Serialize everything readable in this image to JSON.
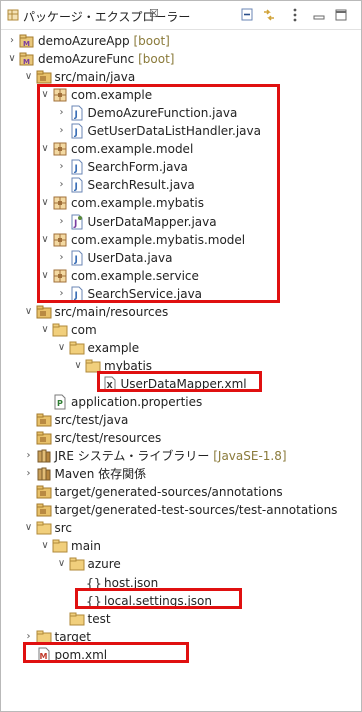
{
  "view": {
    "title": "パッケージ・エクスプローラー",
    "close_glyph": "☒",
    "toolbar": [
      "collapse-all-icon",
      "link-with-editor-icon",
      "view-menu-icon",
      "minimize-icon",
      "maximize-icon"
    ]
  },
  "tree": [
    {
      "label": "demoAzureApp",
      "suffix": " [boot]",
      "icon": "project-icon",
      "arrow": "right"
    },
    {
      "label": "demoAzureFunc",
      "suffix": " [boot]",
      "icon": "project-icon",
      "arrow": "down"
    },
    {
      "label": "src/main/java",
      "icon": "source-folder-icon",
      "arrow": "down"
    },
    {
      "label": "com.example",
      "icon": "package-icon",
      "arrow": "down"
    },
    {
      "label": "DemoAzureFunction.java",
      "icon": "java-file-icon",
      "arrow": "right"
    },
    {
      "label": "GetUserDataListHandler.java",
      "icon": "java-file-icon",
      "arrow": "right"
    },
    {
      "label": "com.example.model",
      "icon": "package-icon",
      "arrow": "down"
    },
    {
      "label": "SearchForm.java",
      "icon": "java-file-icon",
      "arrow": "right"
    },
    {
      "label": "SearchResult.java",
      "icon": "java-file-icon",
      "arrow": "right"
    },
    {
      "label": "com.example.mybatis",
      "icon": "package-icon",
      "arrow": "down"
    },
    {
      "label": "UserDataMapper.java",
      "icon": "java-interface-icon",
      "arrow": "right"
    },
    {
      "label": "com.example.mybatis.model",
      "icon": "package-icon",
      "arrow": "down"
    },
    {
      "label": "UserData.java",
      "icon": "java-file-icon",
      "arrow": "right"
    },
    {
      "label": "com.example.service",
      "icon": "package-icon",
      "arrow": "down"
    },
    {
      "label": "SearchService.java",
      "icon": "java-file-icon",
      "arrow": "right"
    },
    {
      "label": "src/main/resources",
      "icon": "source-folder-icon",
      "arrow": "down"
    },
    {
      "label": "com",
      "icon": "folder-icon",
      "arrow": "down"
    },
    {
      "label": "example",
      "icon": "folder-icon",
      "arrow": "down"
    },
    {
      "label": "mybatis",
      "icon": "folder-icon",
      "arrow": "down"
    },
    {
      "label": "UserDataMapper.xml",
      "icon": "xml-file-icon",
      "arrow": "none"
    },
    {
      "label": "application.properties",
      "icon": "properties-file-icon",
      "arrow": "none"
    },
    {
      "label": "src/test/java",
      "icon": "source-folder-icon",
      "arrow": "none"
    },
    {
      "label": "src/test/resources",
      "icon": "source-folder-icon",
      "arrow": "none"
    },
    {
      "label": "JRE システム・ライブラリー",
      "suffix": " [JavaSE-1.8]",
      "icon": "library-icon",
      "arrow": "right"
    },
    {
      "label": "Maven 依存関係",
      "icon": "library-icon",
      "arrow": "right"
    },
    {
      "label": "target/generated-sources/annotations",
      "icon": "source-folder-icon",
      "arrow": "none"
    },
    {
      "label": "target/generated-test-sources/test-annotations",
      "icon": "source-folder-icon",
      "arrow": "none"
    },
    {
      "label": "src",
      "icon": "folder-icon",
      "arrow": "down"
    },
    {
      "label": "main",
      "icon": "folder-icon",
      "arrow": "down"
    },
    {
      "label": "azure",
      "icon": "folder-icon",
      "arrow": "down"
    },
    {
      "label": "host.json",
      "icon": "json-file-icon",
      "arrow": "none"
    },
    {
      "label": "local.settings.json",
      "icon": "json-file-icon",
      "arrow": "none"
    },
    {
      "label": "test",
      "icon": "folder-icon",
      "arrow": "none"
    },
    {
      "label": "target",
      "icon": "folder-icon",
      "arrow": "right"
    },
    {
      "label": "pom.xml",
      "icon": "maven-pom-icon",
      "arrow": "none"
    }
  ],
  "colors": {
    "highlight": "#e01010",
    "package": "#a0703a",
    "folder": "#e8c16a",
    "java": "#3b6fb6",
    "suffix": "#8a7a3a"
  }
}
